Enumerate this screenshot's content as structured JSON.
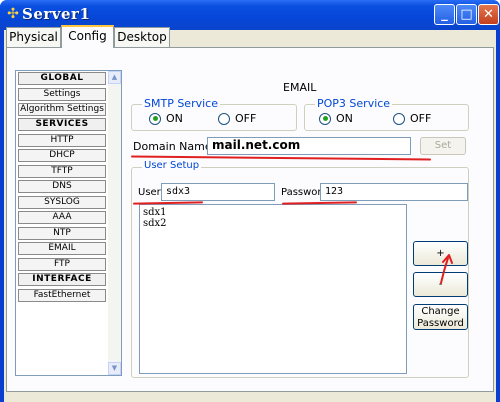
{
  "window": {
    "title": "Server1"
  },
  "tabs": [
    {
      "label": "Physical"
    },
    {
      "label": "Config"
    },
    {
      "label": "Desktop"
    }
  ],
  "sidebar": {
    "items": [
      {
        "label": "GLOBAL",
        "header": true
      },
      {
        "label": "Settings"
      },
      {
        "label": "Algorithm Settings"
      },
      {
        "label": "SERVICES",
        "header": true
      },
      {
        "label": "HTTP"
      },
      {
        "label": "DHCP"
      },
      {
        "label": "TFTP"
      },
      {
        "label": "DNS"
      },
      {
        "label": "SYSLOG"
      },
      {
        "label": "AAA"
      },
      {
        "label": "NTP"
      },
      {
        "label": "EMAIL"
      },
      {
        "label": "FTP"
      },
      {
        "label": "INTERFACE",
        "header": true
      },
      {
        "label": "FastEthernet"
      }
    ]
  },
  "main": {
    "title": "EMAIL",
    "smtp": {
      "legend": "SMTP Service",
      "on_label": "ON",
      "off_label": "OFF",
      "selected": "ON"
    },
    "pop3": {
      "legend": "POP3 Service",
      "on_label": "ON",
      "off_label": "OFF",
      "selected": "ON"
    },
    "domain": {
      "label": "Domain Name:",
      "value": "mail.net.com",
      "set_label": "Set"
    },
    "user_setup": {
      "legend": "User Setup",
      "user_label": "User",
      "user_value": "sdx3",
      "password_label": "Password",
      "password_value": "123",
      "users": [
        "sdx1",
        "sdx2"
      ],
      "add_label": "+",
      "remove_label": "-",
      "change_password_line1": "Change",
      "change_password_line2": "Password"
    }
  },
  "colors": {
    "annotation": "#e02020",
    "legend_text": "#0046d5",
    "titlebar": "#0a4fe0"
  },
  "icons": {
    "window": "packet-tracer-icon",
    "minimize": "minimize-icon",
    "maximize": "maximize-icon",
    "close": "close-icon"
  }
}
